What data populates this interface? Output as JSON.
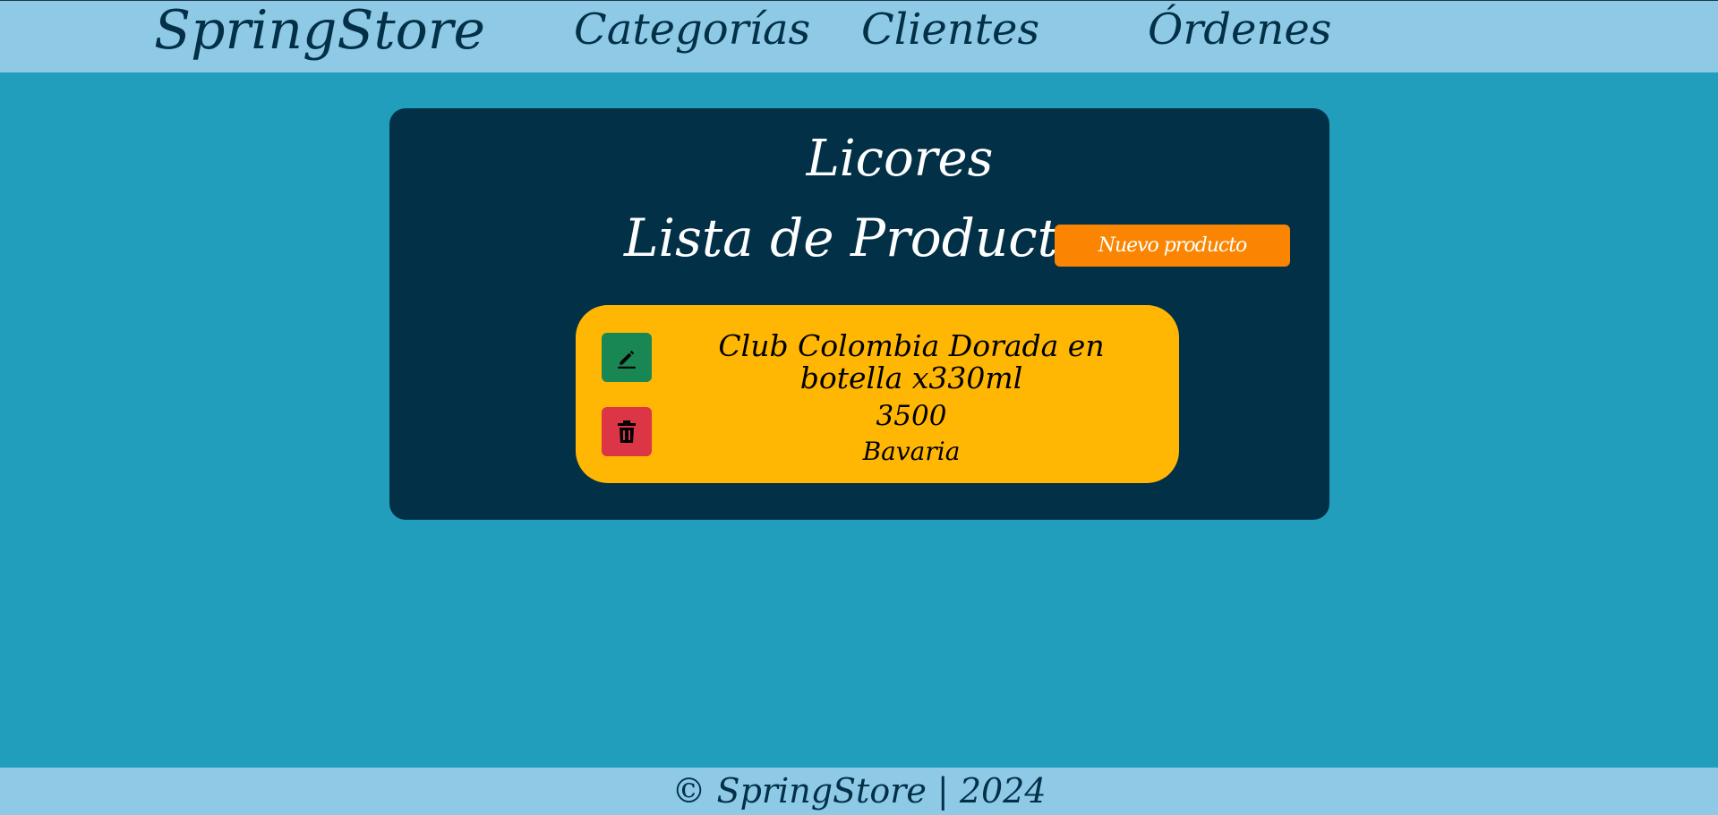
{
  "navbar": {
    "brand": "SpringStore",
    "links": [
      "Categorías",
      "Clientes",
      "Órdenes"
    ]
  },
  "main": {
    "category_title": "Licores",
    "list_title": "Lista de Productos",
    "new_product_label": "Nuevo producto",
    "products": [
      {
        "name": "Club Colombia Dorada en botella x330ml",
        "price": "3500",
        "brand": "Bavaria",
        "actions": {
          "edit_icon": "pencil-icon",
          "delete_icon": "trash-icon"
        }
      }
    ]
  },
  "footer": {
    "text": "© SpringStore | 2024"
  },
  "colors": {
    "background": "#219ebc",
    "navbar": "#8ecae6",
    "panel": "#023047",
    "card": "#ffb703",
    "new_button": "#fb8500",
    "edit_button": "#198754",
    "delete_button": "#dc3545"
  }
}
